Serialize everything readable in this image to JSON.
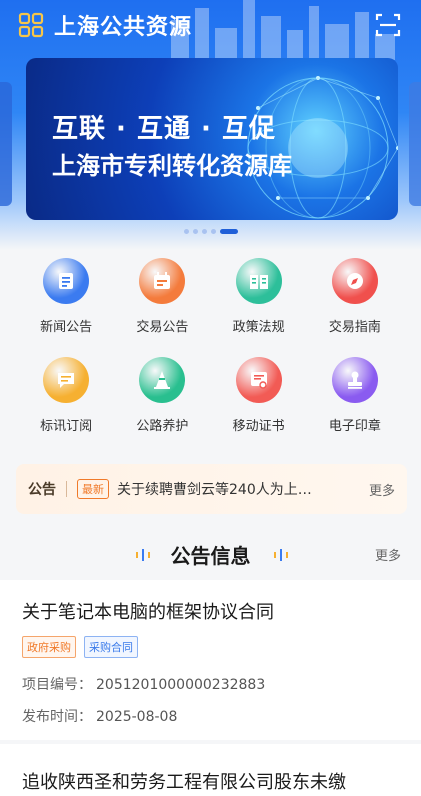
{
  "header": {
    "title": "上海公共资源",
    "logo_icon": "logo-grid-icon",
    "scan_icon": "scan-icon"
  },
  "banner": {
    "line1": "互联 · 互通 · 互促",
    "line2": "上海市专利转化资源库",
    "page_count": 5,
    "active_page": 5
  },
  "grid": [
    {
      "label": "新闻公告",
      "icon": "news-icon",
      "color": "#3b7bf0"
    },
    {
      "label": "交易公告",
      "icon": "calendar-icon",
      "color": "#f47b3c"
    },
    {
      "label": "政策法规",
      "icon": "book-icon",
      "color": "#2dbf9a"
    },
    {
      "label": "交易指南",
      "icon": "compass-icon",
      "color": "#f0504d"
    },
    {
      "label": "标讯订阅",
      "icon": "message-icon",
      "color": "#f6b031"
    },
    {
      "label": "公路养护",
      "icon": "road-cone-icon",
      "color": "#29bf8f"
    },
    {
      "label": "移动证书",
      "icon": "certificate-icon",
      "color": "#f25b55"
    },
    {
      "label": "电子印章",
      "icon": "stamp-icon",
      "color": "#8a5bf0"
    }
  ],
  "notice": {
    "tag": "公告",
    "badge": "最新",
    "text": "关于续聘曹剑云等240人为上…",
    "more": "更多"
  },
  "section": {
    "title": "公告信息",
    "more": "更多"
  },
  "items": [
    {
      "title": "关于笔记本电脑的框架协议合同",
      "tags": [
        "政府采购",
        "采购合同"
      ],
      "project_label": "项目编号：",
      "project_no": "2051201000000232883",
      "date_label": "发布时间：",
      "date": "2025-08-08"
    },
    {
      "title": "追收陕西圣和劳务工程有限公司股东未缴"
    }
  ]
}
